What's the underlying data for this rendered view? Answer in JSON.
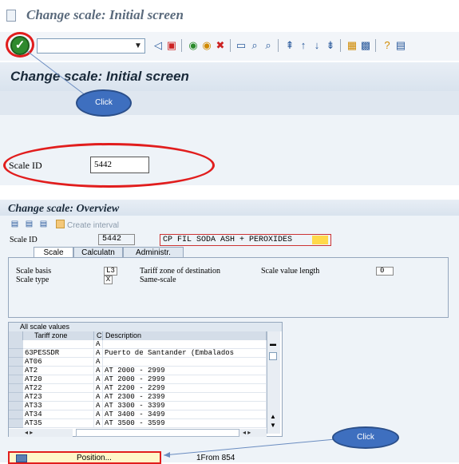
{
  "top_screen": {
    "window_title": "Change scale: Initial screen",
    "screen_title": "Change scale: Initial screen",
    "click_label": "Click",
    "scale_id_label": "Scale ID",
    "scale_id_value": "5442",
    "toolbar_icons": [
      "enter-icon",
      "command-field",
      "dropdown-icon",
      "back-nav-icon",
      "save-icon",
      "back-icon",
      "exit-icon",
      "cancel-icon",
      "print-icon",
      "find-icon",
      "find-next-icon",
      "first-page-icon",
      "prev-page-icon",
      "next-page-icon",
      "last-page-icon",
      "create-session-icon",
      "shortcut-icon",
      "help-icon",
      "customize-icon"
    ]
  },
  "bottom_screen": {
    "screen_title": "Change scale: Overview",
    "create_interval_label": "Create interval",
    "scale_id_label": "Scale ID",
    "scale_id_value": "5442",
    "scale_description": "CP FIL SODA ASH + PEROXIDES",
    "tabs": [
      "Scale",
      "Calculatn",
      "Administr."
    ],
    "active_tab": "Scale",
    "scale_basis_label": "Scale basis",
    "scale_basis_value": "L3",
    "scale_type_label": "Scale type",
    "scale_type_value": "X",
    "tariff_zone_dest_label": "Tariff zone of destination",
    "scale_type_text": "Same-scale",
    "scale_value_length_label": "Scale value length",
    "scale_value_length_value": "0",
    "table_title": "All scale values",
    "table_headers": [
      "Tariff zone",
      "C",
      "Description"
    ],
    "table_rows": [
      {
        "zone": "",
        "c": "A",
        "desc": ""
      },
      {
        "zone": "63PESSDR",
        "c": "A",
        "desc": "Puerto de Santander (Embalados"
      },
      {
        "zone": "AT06",
        "c": "A",
        "desc": ""
      },
      {
        "zone": "AT2",
        "c": "A",
        "desc": "AT 2000 - 2999"
      },
      {
        "zone": "AT20",
        "c": "A",
        "desc": "AT 2000 - 2999"
      },
      {
        "zone": "AT22",
        "c": "A",
        "desc": "AT 2200 - 2299"
      },
      {
        "zone": "AT23",
        "c": "A",
        "desc": "AT 2300 - 2399"
      },
      {
        "zone": "AT33",
        "c": "A",
        "desc": "AT 3300 - 3399"
      },
      {
        "zone": "AT34",
        "c": "A",
        "desc": "AT 3400 - 3499"
      },
      {
        "zone": "AT35",
        "c": "A",
        "desc": "AT 3500 - 3599"
      }
    ],
    "position_button_label": "Position...",
    "entry_counter": "1From 854",
    "click_label": "Click"
  },
  "colors": {
    "highlight_ring": "#e11d1d",
    "callout": "#3e6fbf",
    "sap_bg": "#eef3f8"
  }
}
